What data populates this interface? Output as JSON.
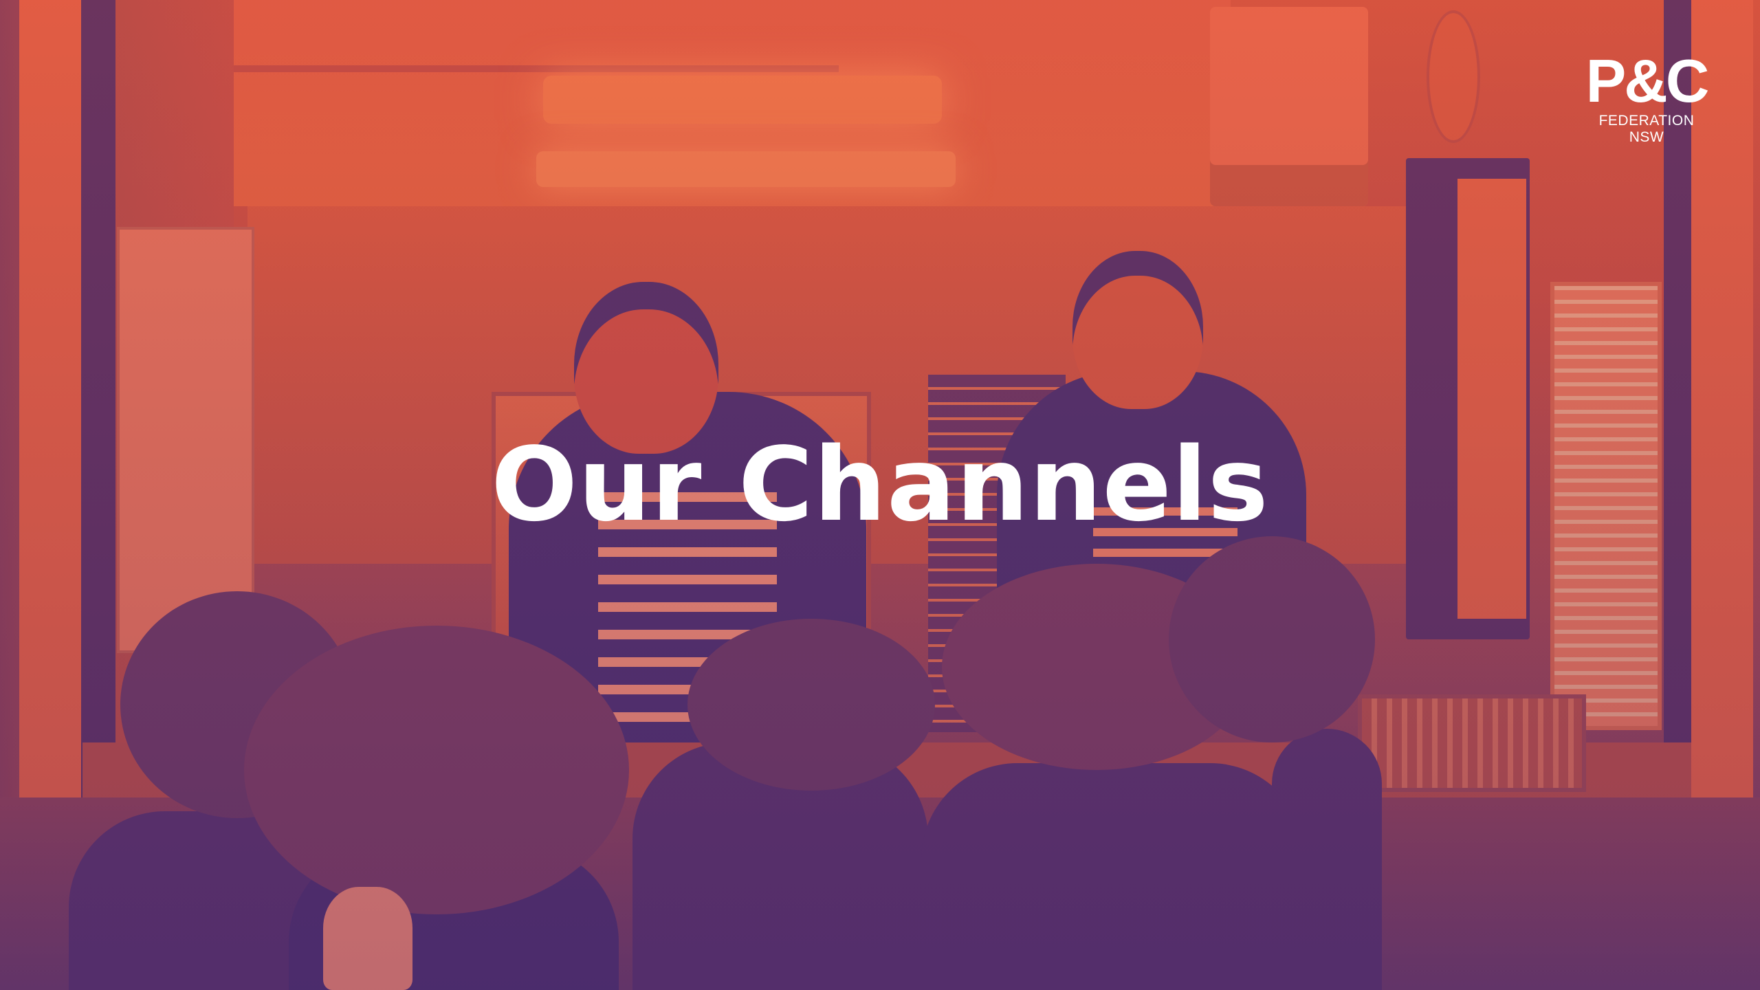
{
  "slide": {
    "title": "Our Channels"
  },
  "logo": {
    "mark": "P&C",
    "subtitle": "FEDERATION NSW"
  },
  "colors": {
    "duotone_light": "#e15d44",
    "duotone_dark": "#4b2d6d",
    "text": "#ffffff"
  }
}
